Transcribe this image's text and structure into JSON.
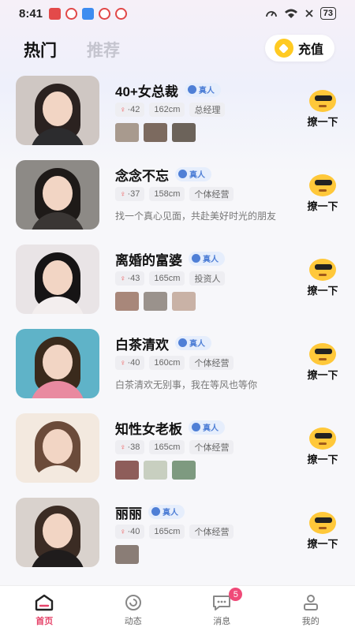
{
  "status": {
    "time": "8:41",
    "battery": "73"
  },
  "header": {
    "tab_hot": "热门",
    "tab_recommend": "推荐",
    "recharge_label": "充值"
  },
  "verified_label": "真人",
  "say_hi_label": "撩一下",
  "users": [
    {
      "name": "40+女总裁",
      "age": "42",
      "height": "162cm",
      "job": "总经理",
      "bio": "",
      "photos": 3,
      "colors": {
        "bg": "#cfc7c3",
        "hair": "#2b2220",
        "body": "#2c2c2e"
      }
    },
    {
      "name": "念念不忘",
      "age": "37",
      "height": "158cm",
      "job": "个体经营",
      "bio": "找一个真心见面，共赴美好时光的朋友",
      "colors": {
        "bg": "#8d8a86",
        "hair": "#1e1a18",
        "body": "#3a3634"
      }
    },
    {
      "name": "离婚的富婆",
      "age": "43",
      "height": "165cm",
      "job": "投资人",
      "bio": "",
      "photos": 3,
      "colors": {
        "bg": "#e9e4e6",
        "hair": "#161415",
        "body": "#f3eeee"
      }
    },
    {
      "name": "白茶清欢",
      "age": "40",
      "height": "160cm",
      "job": "个体经营",
      "bio": "白茶清欢无别事，我在等风也等你",
      "colors": {
        "bg": "#5fb3c8",
        "hair": "#3a2a1c",
        "body": "#e98aa0"
      }
    },
    {
      "name": "知性女老板",
      "age": "38",
      "height": "165cm",
      "job": "个体经营",
      "bio": "",
      "photos": 3,
      "colors": {
        "bg": "#f3e9df",
        "hair": "#6b4b3a",
        "body": "#f3e9df"
      }
    },
    {
      "name": "丽丽",
      "age": "40",
      "height": "165cm",
      "job": "个体经营",
      "bio": "",
      "photos": 1,
      "colors": {
        "bg": "#d9d2cd",
        "hair": "#3b2c24",
        "body": "#1f1c1c"
      }
    }
  ],
  "nav": {
    "home": "首页",
    "moments": "动态",
    "messages": "消息",
    "messages_badge": "5",
    "mine": "我的",
    "active_color": "#e6446a"
  }
}
